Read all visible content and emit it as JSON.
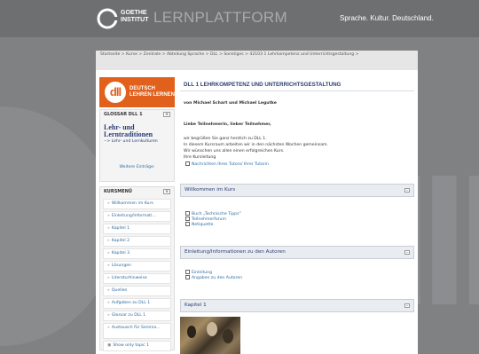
{
  "header": {
    "logo_text": "GOETHE\nINSTITUT",
    "platform_title": "LERNPLATTFORM",
    "tagline": "Sprache. Kultur. Deutschland."
  },
  "breadcrumb": "Startseite > Kurse > Zentrale > Abteilung Sprache > DLL > Sonstiges > 42103 1 Lehrkompetenz und Unterrichtsgestaltung >",
  "sidebar": {
    "brand_mark": "dll",
    "brand_text": "DEUTSCH\nLEHREN LERNEN",
    "glossary": {
      "title": "GLOSSAR DLL 1",
      "term": "Lehr- und Lerntraditionen",
      "term_link": "--> Lehr- und Lernkulturen",
      "more": "Weitere Einträge:"
    },
    "menu": {
      "title": "KURSMENÜ",
      "items": [
        "Willkommen im Kurs",
        "Einleitung/Informati...",
        "Kapitel 1",
        "Kapitel 2",
        "Kapitel 3",
        "Lösungen",
        "Literaturhinweise",
        "Quellen",
        "Aufgaben zu DLL 1",
        "Glossar zu DLL 1",
        "Austausch für Semina...",
        "Show only topic 1"
      ]
    }
  },
  "main": {
    "title": "DLL 1 LEHRKOMPETENZ UND UNTERRICHTSGESTALTUNG",
    "authors": "von Michael Schart und Michael Legutke",
    "greeting": "Liebe Teilnehmerin, lieber Teilnehmer,",
    "body_lines": [
      "wir begrüßen Sie ganz herzlich zu DLL 1.",
      "In diesem Kursraum arbeiten wir in den nächsten Wochen gemeinsam.",
      "Wir wünschen uns allen einen erfolgreichen Kurs.",
      "Ihre Kursleitung"
    ],
    "tutor_link": "Nachrichten Ihres Tutors/ Ihrer Tutorin",
    "sections": [
      {
        "title": "Willkommen im Kurs",
        "resources": [
          "Buch „Technische Tipps“",
          "Teilnehmerforum",
          "Netiquette"
        ]
      },
      {
        "title": "Einleitung/Informationen zu den Autoren",
        "resources": [
          "Einleitung",
          "Angaben zu den Autoren"
        ]
      },
      {
        "title": "Kapitel 1",
        "resources": []
      }
    ]
  },
  "colors": {
    "background": "#7f8183",
    "accent_orange": "#e0601c",
    "title_blue": "#2c3e73",
    "link_blue": "#2c6aa0"
  }
}
